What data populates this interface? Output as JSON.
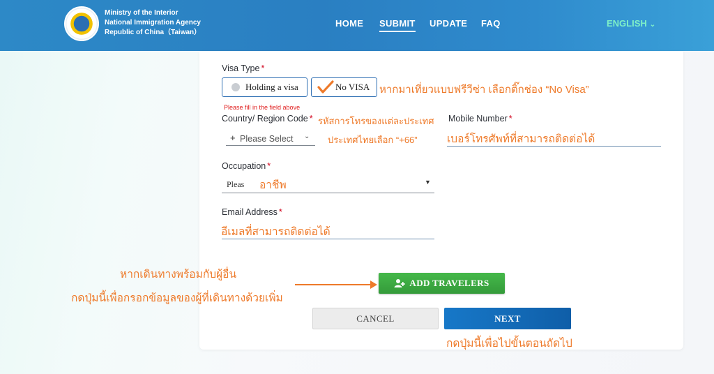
{
  "header": {
    "org_lines": [
      "Ministry of the Interior",
      "National Immigration Agency",
      "Republic of China（Taiwan）"
    ],
    "nav": [
      "HOME",
      "SUBMIT",
      "UPDATE",
      "FAQ"
    ],
    "active_nav": "SUBMIT",
    "language": "ENGLISH"
  },
  "form": {
    "visa_type_label": "Visa Type",
    "visa_options": [
      "Holding a visa",
      "No VISA"
    ],
    "visa_selected": "No VISA",
    "error_message": "Please fill in the field above",
    "country_code_label": "Country/ Region Code",
    "country_code_prefix": "+",
    "country_code_placeholder": "Please Select",
    "mobile_label": "Mobile Number",
    "occupation_label": "Occupation",
    "occupation_placeholder": "Pleas",
    "email_label": "Email Address",
    "required_marker": "*"
  },
  "buttons": {
    "add_travelers": "ADD TRAVELERS",
    "cancel": "CANCEL",
    "next": "NEXT"
  },
  "annotations": {
    "no_visa_tip": "หากมาเที่ยวแบบฟรีวีซ่า เลือกติ๊กช่อง “No Visa”",
    "country_code_tip": "รหัสการโทรของแต่ละประเทศ",
    "thai_code_tip": "ประเทศไทยเลือก “+66”",
    "mobile_tip": "เบอร์โทรศัพท์ที่สามารถติดต่อได้",
    "occupation_tip": "อาชีพ",
    "email_tip": "อีเมลที่สามารถติดต่อได้",
    "travel_with_others_1": "หากเดินทางพร้อมกับผู้อื่น",
    "travel_with_others_2": "กดปุ่มนี้เพื่อกรอกข้อมูลของผู้ที่เดินทางด้วยเพิ่ม",
    "next_tip": "กดปุ่มนี้เพื่อไปขั้นตอนถัดไป"
  },
  "colors": {
    "header_blue": "#2a7fc2",
    "annotation_orange": "#ee7a2a",
    "add_button_green": "#3aa83f",
    "next_button_blue": "#1370c0",
    "required_red": "#d0021b",
    "language_mint": "#7ef0c8"
  },
  "icons": {
    "add_travelers": "add-user-icon",
    "country_select": "chevron-down-icon",
    "occupation_select": "caret-down-icon",
    "language": "chevron-down-icon",
    "no_visa_mark": "checkmark-icon"
  }
}
